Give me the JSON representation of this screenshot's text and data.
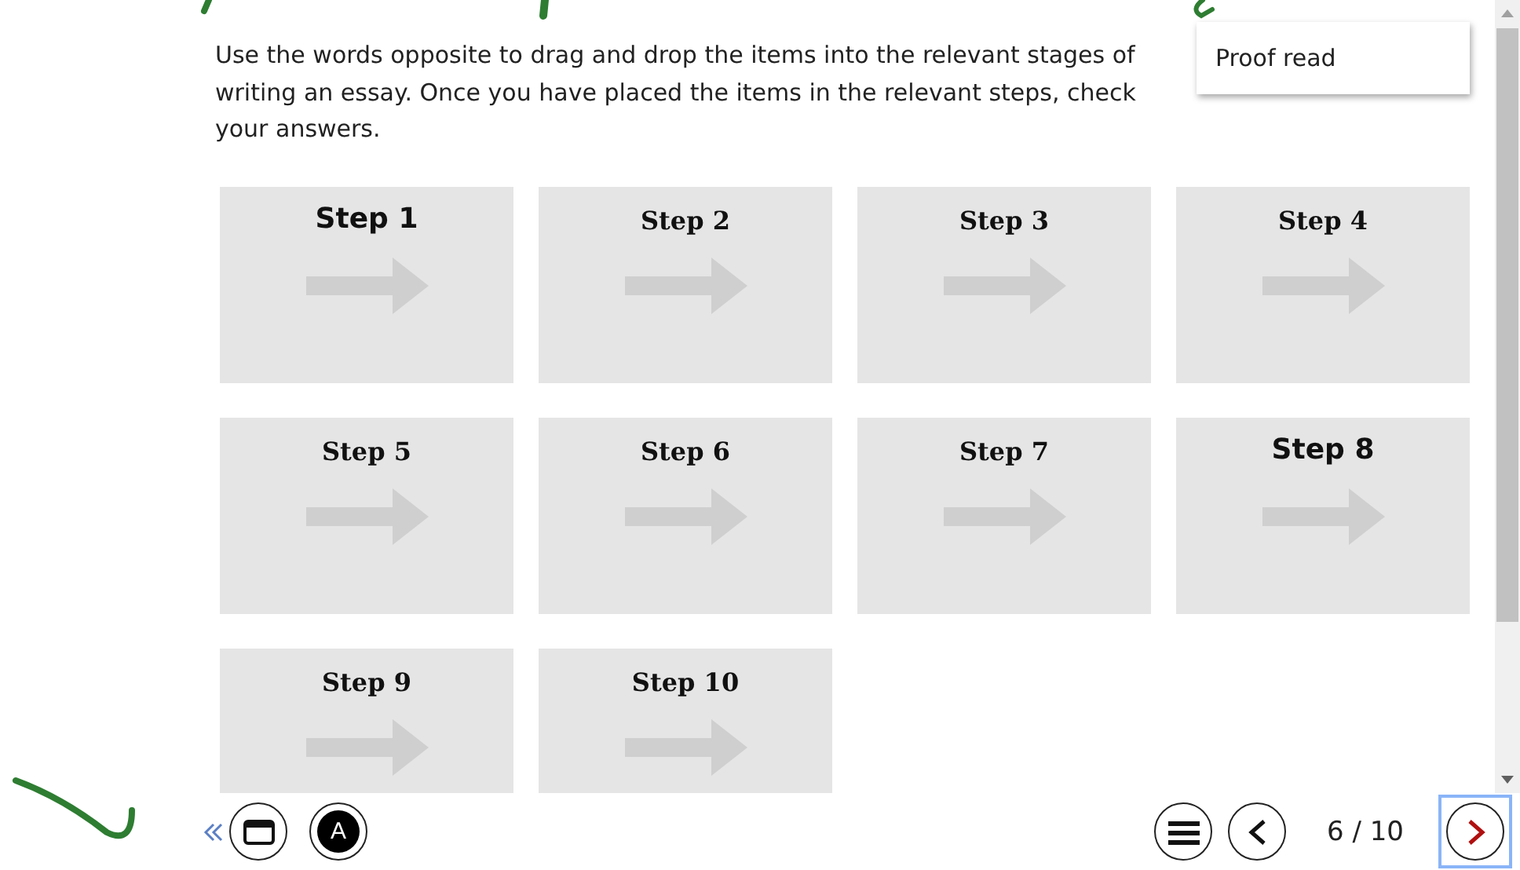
{
  "instructions": "Use the words opposite to drag and drop the items into the relevant stages of writing an essay. Once you have placed the items in the relevant steps, check your answers.",
  "drag_item": {
    "label": "Proof read"
  },
  "steps": [
    {
      "label": "Step 1",
      "kind": "sans"
    },
    {
      "label": "Step 2",
      "kind": "serif"
    },
    {
      "label": "Step 3",
      "kind": "serif"
    },
    {
      "label": "Step 4",
      "kind": "serif"
    },
    {
      "label": "Step 5",
      "kind": "serif"
    },
    {
      "label": "Step 6",
      "kind": "serif"
    },
    {
      "label": "Step 7",
      "kind": "serif"
    },
    {
      "label": "Step 8",
      "kind": "sans"
    },
    {
      "label": "Step 9",
      "kind": "serif"
    },
    {
      "label": "Step 10",
      "kind": "serif"
    }
  ],
  "footer": {
    "page_indicator": "6 / 10",
    "next_focused": true,
    "avatar_letter": "A"
  }
}
